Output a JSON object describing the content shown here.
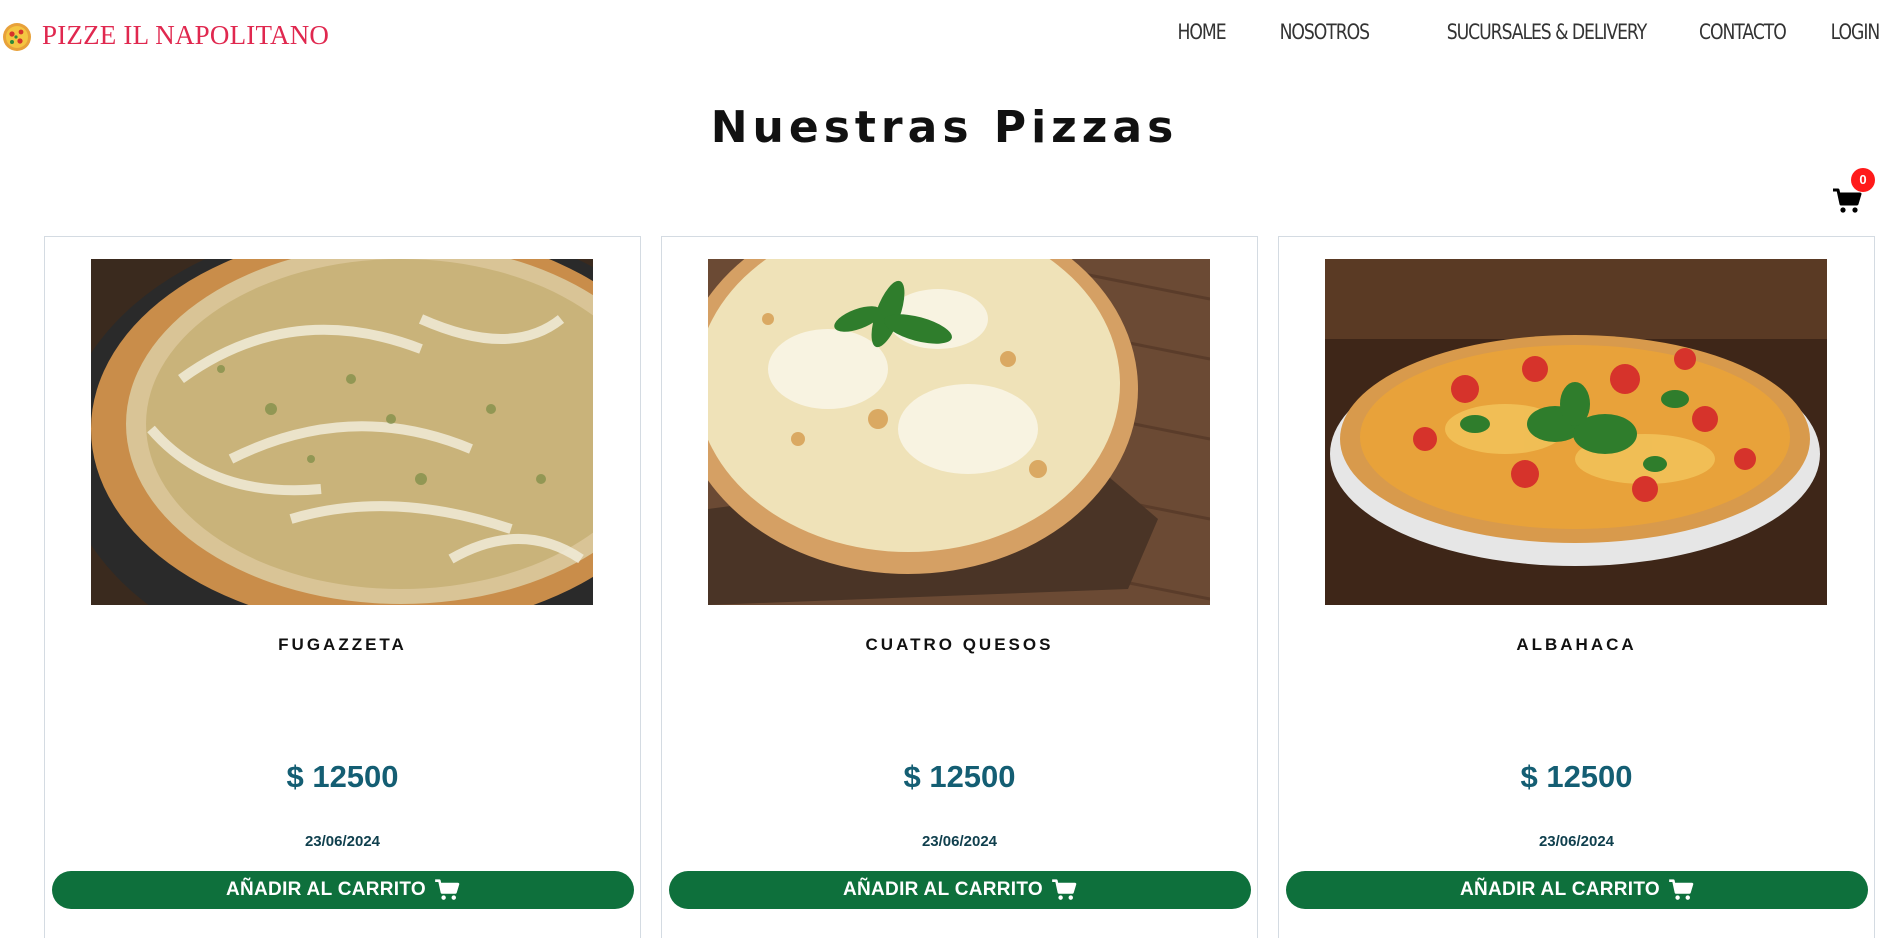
{
  "brand": {
    "name": "PIZZE IL NAPOLITANO",
    "color": "#e0284f"
  },
  "nav": {
    "items": [
      {
        "label": "HOME"
      },
      {
        "label": "NOSOTROS"
      },
      {
        "label": "SUCURSALES & DELIVERY"
      },
      {
        "label": "CONTACTO"
      },
      {
        "label": "LOGIN"
      }
    ]
  },
  "main": {
    "title": "Nuestras Pizzas"
  },
  "cart": {
    "count": "0",
    "icon": "shopping-cart-icon"
  },
  "products": [
    {
      "name": "FUGAZZETA",
      "price": "$ 12500",
      "date": "23/06/2024",
      "button": "AÑADIR AL CARRITO"
    },
    {
      "name": "CUATRO QUESOS",
      "price": "$ 12500",
      "date": "23/06/2024",
      "button": "AÑADIR AL CARRITO"
    },
    {
      "name": "ALBAHACA",
      "price": "$ 12500",
      "date": "23/06/2024",
      "button": "AÑADIR AL CARRITO"
    }
  ],
  "colors": {
    "accent_green": "#0e703c",
    "price_blue": "#145e73",
    "badge_red": "#ff1a1a"
  }
}
